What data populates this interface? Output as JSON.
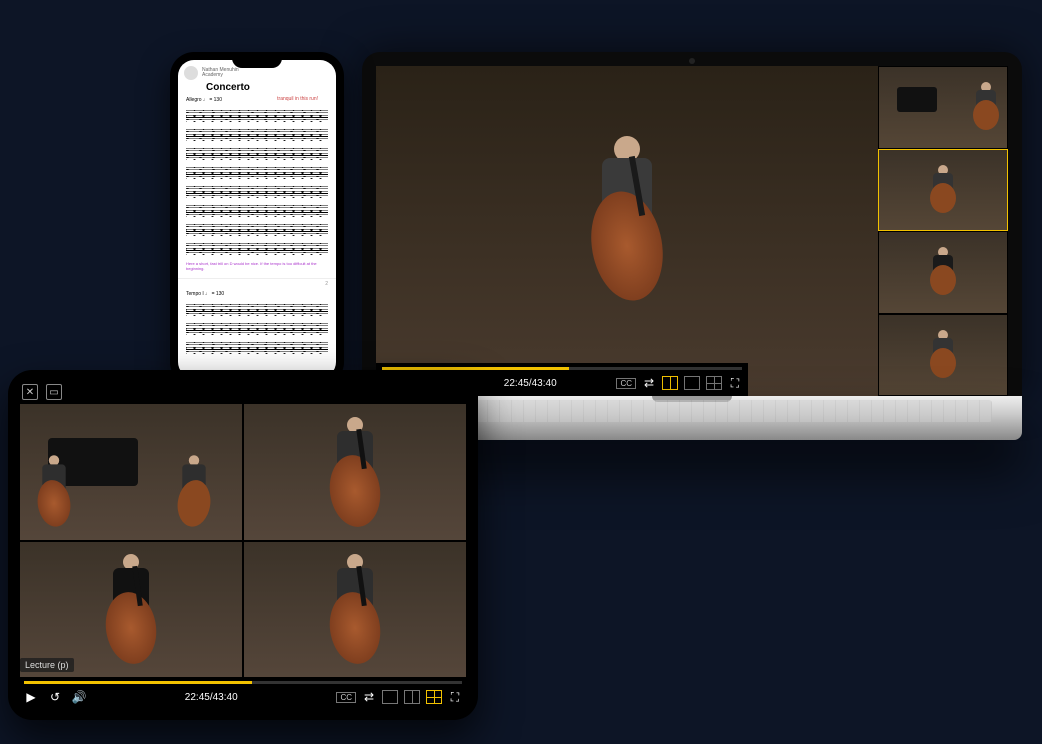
{
  "phone": {
    "brand_line1": "Nathan Menuhin",
    "brand_line2": "Academy",
    "title": "Concerto",
    "tempo1": "Allegro ♩ = 130",
    "annotation_red": "tranquil in this run!",
    "footnote_purple": "Here a short, fast trill on D would be nice. If the tempo is too difficult at the beginning.",
    "tempo2": "Tempo I ♩ = 130",
    "page2": "2"
  },
  "laptop": {
    "timecode": "22:45/43:40",
    "cc": "CC"
  },
  "tablet": {
    "label": "Lecture (p)",
    "timecode": "22:45/43:40",
    "cc": "CC"
  }
}
